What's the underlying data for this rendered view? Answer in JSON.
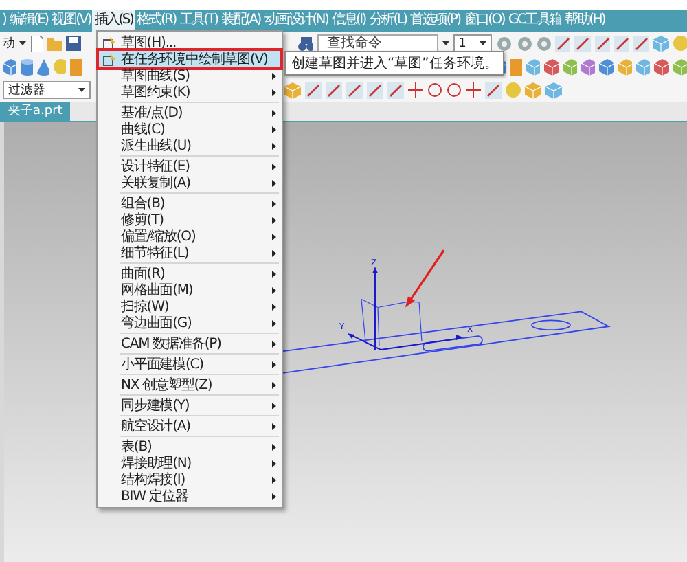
{
  "menubar": [
    {
      "label": ")",
      "selected": false
    },
    {
      "label": "编辑(E)",
      "selected": false
    },
    {
      "label": "视图(V)",
      "selected": false
    },
    {
      "label": "插入(S)",
      "selected": true
    },
    {
      "label": "格式(R)",
      "selected": false
    },
    {
      "label": "工具(T)",
      "selected": false
    },
    {
      "label": "装配(A)",
      "selected": false
    },
    {
      "label": "动画设计(N)",
      "selected": false
    },
    {
      "label": "信息(I)",
      "selected": false
    },
    {
      "label": "分析(L)",
      "selected": false
    },
    {
      "label": "首选项(P)",
      "selected": false
    },
    {
      "label": "窗口(O)",
      "selected": false
    },
    {
      "label": "GC工具箱",
      "selected": false
    },
    {
      "label": "帮助(H)",
      "selected": false
    }
  ],
  "toolbar": {
    "start_label": "动",
    "search": {
      "placeholder": "查找命令"
    },
    "layer_dropdown": "1",
    "filter_dropdown": "过滤器"
  },
  "tabs": [
    {
      "label": "夹子a.prt",
      "selected": true
    }
  ],
  "insert_menu": [
    [
      {
        "label": "草图(H)...",
        "submenu": false,
        "has_icon": true,
        "selected": false
      },
      {
        "label": "在任务环境中绘制草图(V)",
        "submenu": false,
        "has_icon": true,
        "selected": true
      },
      {
        "label": "草图曲线(S)",
        "submenu": true,
        "has_icon": false,
        "selected": false
      },
      {
        "label": "草图约束(K)",
        "submenu": true,
        "has_icon": false,
        "selected": false
      }
    ],
    [
      {
        "label": "基准/点(D)",
        "submenu": true,
        "has_icon": false,
        "selected": false
      },
      {
        "label": "曲线(C)",
        "submenu": true,
        "has_icon": false,
        "selected": false
      },
      {
        "label": "派生曲线(U)",
        "submenu": true,
        "has_icon": false,
        "selected": false
      }
    ],
    [
      {
        "label": "设计特征(E)",
        "submenu": true,
        "has_icon": false,
        "selected": false
      },
      {
        "label": "关联复制(A)",
        "submenu": true,
        "has_icon": false,
        "selected": false
      }
    ],
    [
      {
        "label": "组合(B)",
        "submenu": true,
        "has_icon": false,
        "selected": false
      },
      {
        "label": "修剪(T)",
        "submenu": true,
        "has_icon": false,
        "selected": false
      },
      {
        "label": "偏置/缩放(O)",
        "submenu": true,
        "has_icon": false,
        "selected": false
      },
      {
        "label": "细节特征(L)",
        "submenu": true,
        "has_icon": false,
        "selected": false
      }
    ],
    [
      {
        "label": "曲面(R)",
        "submenu": true,
        "has_icon": false,
        "selected": false
      },
      {
        "label": "网格曲面(M)",
        "submenu": true,
        "has_icon": false,
        "selected": false
      },
      {
        "label": "扫掠(W)",
        "submenu": true,
        "has_icon": false,
        "selected": false
      },
      {
        "label": "弯边曲面(G)",
        "submenu": true,
        "has_icon": false,
        "selected": false
      }
    ],
    [
      {
        "label": "CAM 数据准备(P)",
        "submenu": true,
        "has_icon": false,
        "selected": false
      }
    ],
    [
      {
        "label": "小平面建模(C)",
        "submenu": true,
        "has_icon": false,
        "selected": false
      }
    ],
    [
      {
        "label": "NX 创意塑型(Z)",
        "submenu": true,
        "has_icon": false,
        "selected": false
      }
    ],
    [
      {
        "label": "同步建模(Y)",
        "submenu": true,
        "has_icon": false,
        "selected": false
      }
    ],
    [
      {
        "label": "航空设计(A)",
        "submenu": true,
        "has_icon": false,
        "selected": false
      }
    ],
    [
      {
        "label": "表(B)",
        "submenu": true,
        "has_icon": false,
        "selected": false
      },
      {
        "label": "焊接助理(N)",
        "submenu": true,
        "has_icon": false,
        "selected": false
      },
      {
        "label": "结构焊接(I)",
        "submenu": true,
        "has_icon": false,
        "selected": false
      },
      {
        "label": "BIW 定位器",
        "submenu": true,
        "has_icon": false,
        "selected": false
      }
    ]
  ],
  "tooltip": "创建草图并进入“草图”任务环境。",
  "viewport": {
    "axes": {
      "x": "X",
      "y": "Y",
      "z": "Z"
    }
  }
}
